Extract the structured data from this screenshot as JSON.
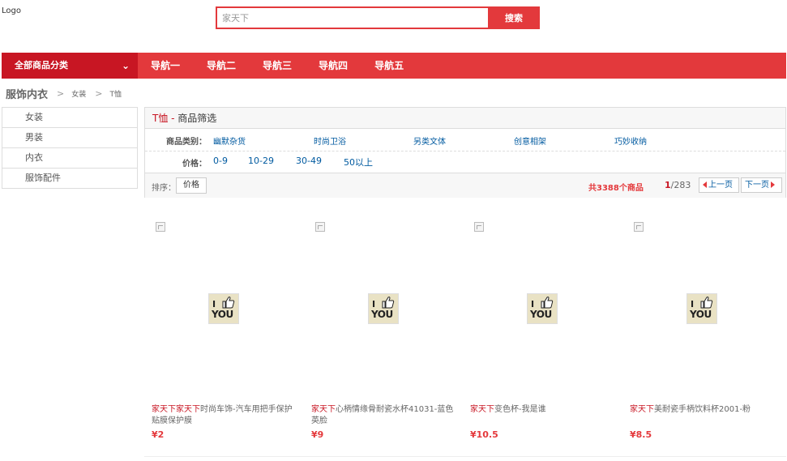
{
  "logo": "Logo",
  "search": {
    "value": "家天下",
    "button": "搜索"
  },
  "nav": {
    "category_label": "全部商品分类",
    "items": [
      "导航一",
      "导航二",
      "导航三",
      "导航四",
      "导航五"
    ]
  },
  "breadcrumb": {
    "main": "服饰内衣",
    "items": [
      "女装",
      "T恤"
    ]
  },
  "sidebar": [
    "女装",
    "男装",
    "内衣",
    "服饰配件"
  ],
  "filter": {
    "title_red": "T恤 - ",
    "title": "商品筛选",
    "category_label": "商品类别：",
    "categories": [
      "幽默杂货",
      "时尚卫浴",
      "另类文体",
      "创意相架",
      "巧妙收纳"
    ],
    "price_label": "价格：",
    "prices": [
      "0-9",
      "10-29",
      "30-49",
      "50以上"
    ]
  },
  "sort": {
    "label": "排序：",
    "button": "价格",
    "total_prefix": "共",
    "total_count": "3388",
    "total_suffix": "个商品",
    "page_current": "1",
    "page_total": "/283",
    "prev": "上一页",
    "next": "下一页"
  },
  "products": [
    {
      "brand": "家天下家天下",
      "title": "时尚车饰-汽车用把手保护贴膜保护膜",
      "price": "¥2"
    },
    {
      "brand": "家天下",
      "title": "心柄情缘骨耐瓷水杯41031-蓝色英脸",
      "price": "¥9"
    },
    {
      "brand": "家天下",
      "title": "变色杯-我是谁",
      "price": "¥10.5"
    },
    {
      "brand": "家天下",
      "title": "美耐瓷手柄饮料杯2001-粉",
      "price": "¥8.5"
    }
  ],
  "thumb_text": {
    "line1": "I",
    "line2": "YOU"
  },
  "colors": {
    "accent": "#e3393c",
    "accent_dark": "#c81623",
    "link": "#005aa0"
  }
}
